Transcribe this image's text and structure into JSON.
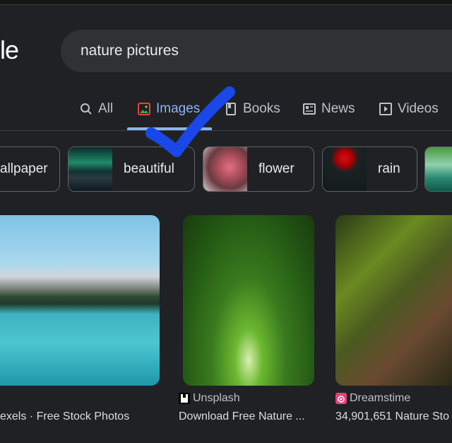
{
  "logo_fragment": "le",
  "search": {
    "query": "nature pictures"
  },
  "tabs": [
    {
      "label": "All",
      "icon": "search-icon"
    },
    {
      "label": "Images",
      "icon": "image-icon",
      "active": true
    },
    {
      "label": "Books",
      "icon": "book-icon"
    },
    {
      "label": "News",
      "icon": "news-icon"
    },
    {
      "label": "Videos",
      "icon": "video-icon"
    }
  ],
  "chips": [
    {
      "label": "allpaper"
    },
    {
      "label": "beautiful"
    },
    {
      "label": "flower"
    },
    {
      "label": "rain"
    },
    {
      "label": ""
    }
  ],
  "results": [
    {
      "source": "",
      "title": "exels · Free Stock Photos"
    },
    {
      "source": "Unsplash",
      "title": "Download Free Nature ..."
    },
    {
      "source": "Dreamstime",
      "title": "34,901,651 Nature Sto"
    }
  ],
  "colors": {
    "accent": "#8ab4f8",
    "background": "#202124",
    "annotation_check": "#1a47e8"
  }
}
